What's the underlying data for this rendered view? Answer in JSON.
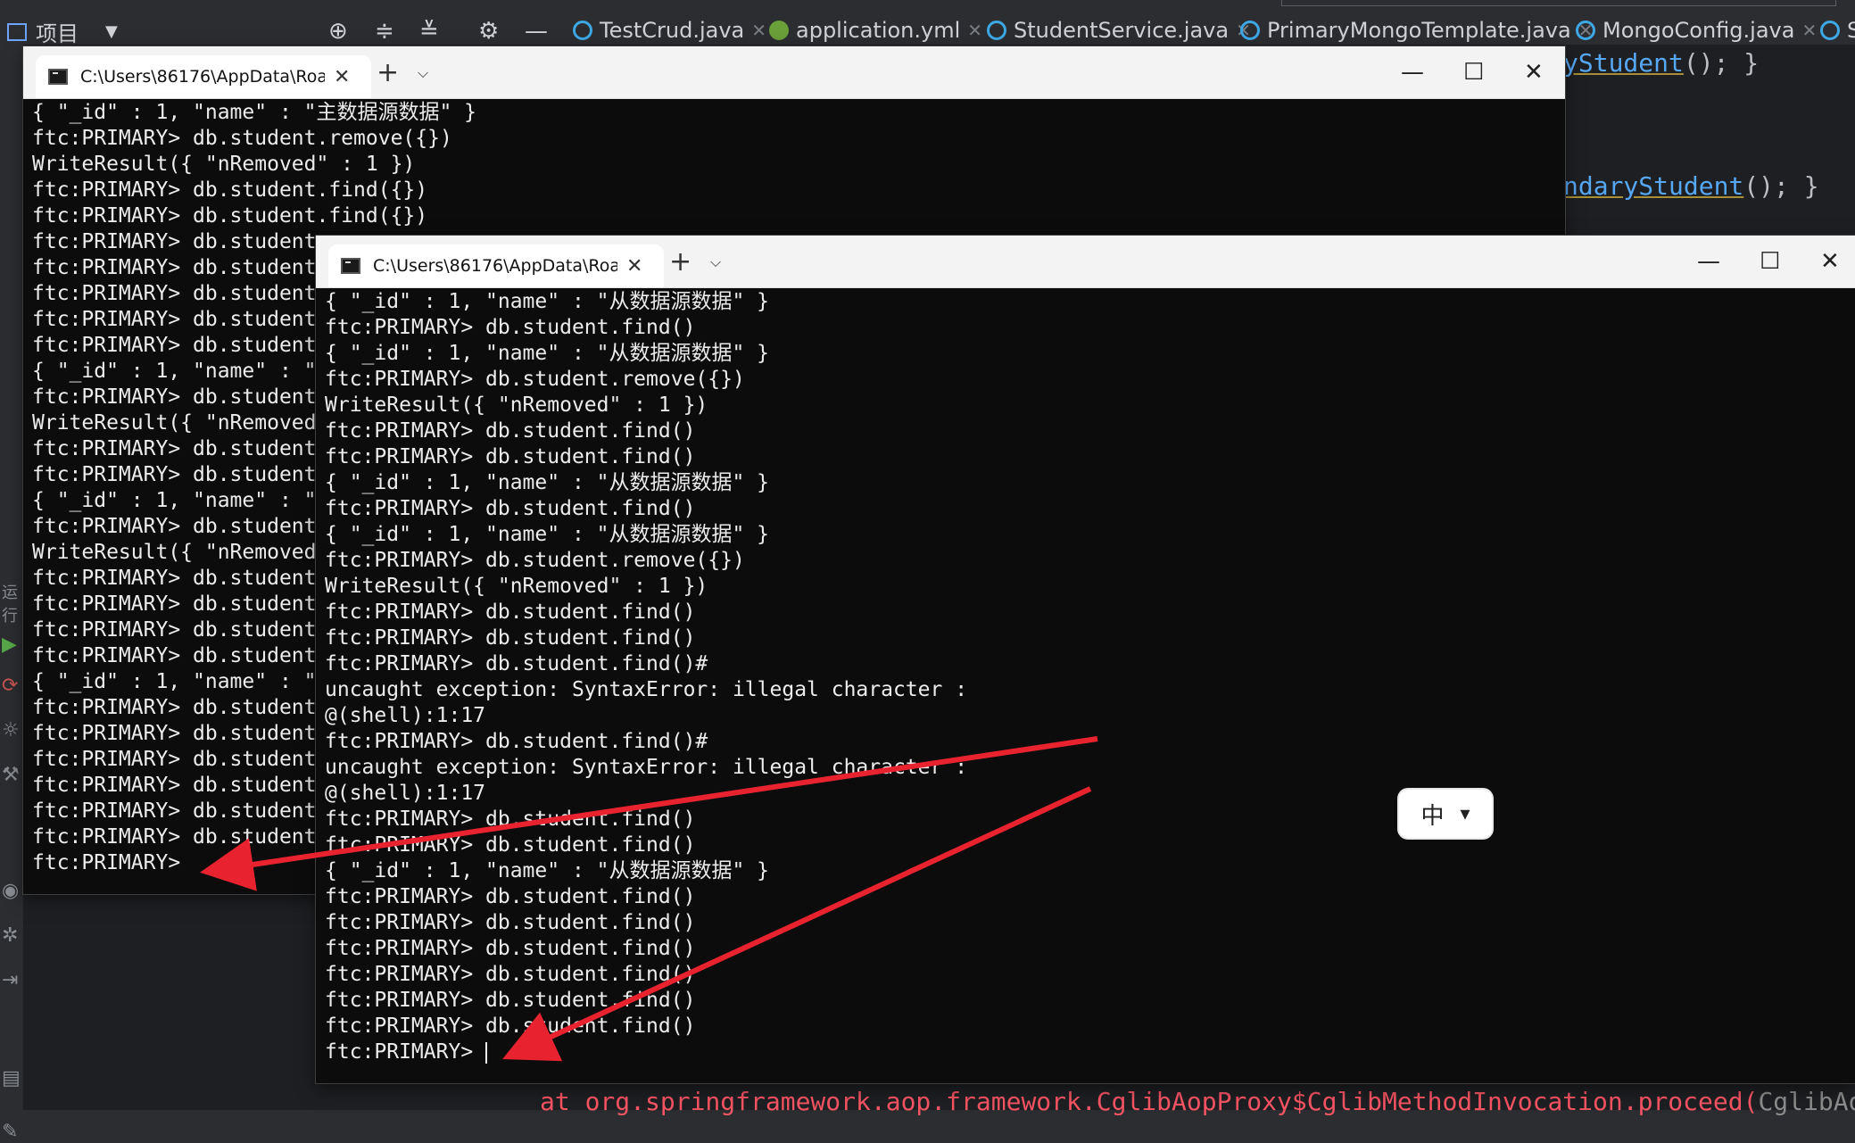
{
  "ide": {
    "project_label": "项目",
    "tabs": [
      {
        "label": "TestCrud.java",
        "icon": "class-icon"
      },
      {
        "label": "application.yml",
        "icon": "yaml-icon"
      },
      {
        "label": "StudentService.java",
        "icon": "class-icon"
      },
      {
        "label": "PrimaryMongoTemplate.java",
        "icon": "class-icon"
      },
      {
        "label": "MongoConfig.java",
        "icon": "class-icon"
      },
      {
        "label": "S",
        "icon": "class-icon"
      }
    ],
    "code_fragment_1_method": "yStudent",
    "code_fragment_1_rest": "(); }",
    "code_fragment_2_method": "ndaryStudent",
    "code_fragment_2_rest": "(); }",
    "error_line": "at org.springframework.aop.framework.CglibAopProxy$CglibMethodInvocation.proceed(",
    "error_line_tail": "CglibAopPro",
    "left_label": "运行"
  },
  "terminal_back": {
    "title": "C:\\Users\\86176\\AppData\\Roai",
    "lines": [
      "{ \"_id\" : 1, \"name\" : \"主数据源数据\" }",
      "ftc:PRIMARY> db.student.remove({})",
      "WriteResult({ \"nRemoved\" : 1 })",
      "ftc:PRIMARY> db.student.find({})",
      "ftc:PRIMARY> db.student.find({})",
      "ftc:PRIMARY> db.student",
      "ftc:PRIMARY> db.student",
      "ftc:PRIMARY> db.student",
      "ftc:PRIMARY> db.student",
      "ftc:PRIMARY> db.student",
      "{ \"_id\" : 1, \"name\" : \"",
      "ftc:PRIMARY> db.student",
      "WriteResult({ \"nRemoved",
      "ftc:PRIMARY> db.student",
      "ftc:PRIMARY> db.student",
      "{ \"_id\" : 1, \"name\" : \"",
      "ftc:PRIMARY> db.student",
      "WriteResult({ \"nRemoved",
      "ftc:PRIMARY> db.student",
      "ftc:PRIMARY> db.student",
      "ftc:PRIMARY> db.student",
      "ftc:PRIMARY> db.student",
      "{ \"_id\" : 1, \"name\" : \"",
      "ftc:PRIMARY> db.student",
      "ftc:PRIMARY> db.student",
      "ftc:PRIMARY> db.student",
      "ftc:PRIMARY> db.student",
      "ftc:PRIMARY> db.student",
      "ftc:PRIMARY> db.student",
      "ftc:PRIMARY>"
    ]
  },
  "terminal_front": {
    "title": "C:\\Users\\86176\\AppData\\Roai",
    "lines": [
      "{ \"_id\" : 1, \"name\" : \"从数据源数据\" }",
      "ftc:PRIMARY> db.student.find()",
      "{ \"_id\" : 1, \"name\" : \"从数据源数据\" }",
      "ftc:PRIMARY> db.student.remove({})",
      "WriteResult({ \"nRemoved\" : 1 })",
      "ftc:PRIMARY> db.student.find()",
      "ftc:PRIMARY> db.student.find()",
      "{ \"_id\" : 1, \"name\" : \"从数据源数据\" }",
      "ftc:PRIMARY> db.student.find()",
      "{ \"_id\" : 1, \"name\" : \"从数据源数据\" }",
      "ftc:PRIMARY> db.student.remove({})",
      "WriteResult({ \"nRemoved\" : 1 })",
      "ftc:PRIMARY> db.student.find()",
      "ftc:PRIMARY> db.student.find()",
      "ftc:PRIMARY> db.student.find()#",
      "uncaught exception: SyntaxError: illegal character :",
      "@(shell):1:17",
      "ftc:PRIMARY> db.student.find()#",
      "uncaught exception: SyntaxError: illegal character :",
      "@(shell):1:17",
      "ftc:PRIMARY> db.student.find()",
      "ftc:PRIMARY> db.student.find()",
      "{ \"_id\" : 1, \"name\" : \"从数据源数据\" }",
      "ftc:PRIMARY> db.student.find()",
      "ftc:PRIMARY> db.student.find()",
      "ftc:PRIMARY> db.student.find()",
      "ftc:PRIMARY> db.student.find()",
      "ftc:PRIMARY> db.student.find()",
      "ftc:PRIMARY> db.student.find()",
      "ftc:PRIMARY> "
    ]
  },
  "window_controls": {
    "minimize": "—",
    "maximize": "☐",
    "close": "✕",
    "new_tab": "+",
    "dropdown": "⌵"
  },
  "ime": {
    "mode": "中",
    "skin_icon": "shirt-icon"
  },
  "colors": {
    "annotation_arrow": "#e8232f",
    "terminal_bg": "#0c0c0c",
    "ide_bg": "#1e1f22"
  }
}
